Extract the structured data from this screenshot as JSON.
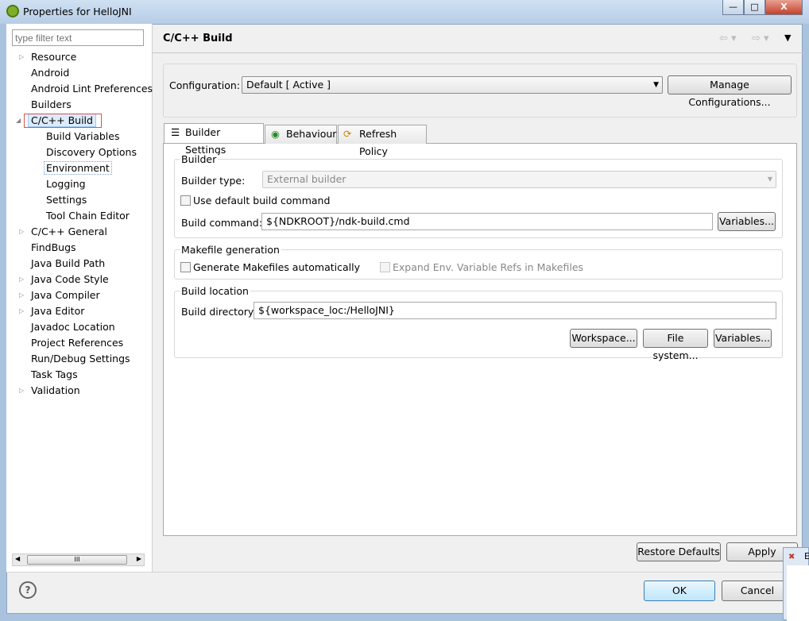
{
  "window": {
    "title": "Properties for HelloJNI",
    "minimize": "—",
    "maximize": "□",
    "close": "X"
  },
  "filter": {
    "placeholder": "type filter text"
  },
  "tree": [
    {
      "label": "Resource",
      "expandable": true
    },
    {
      "label": "Android"
    },
    {
      "label": "Android Lint Preferences"
    },
    {
      "label": "Builders"
    },
    {
      "label": "C/C++ Build",
      "expanded": true,
      "selected": true
    },
    {
      "label": "Build Variables",
      "child": true
    },
    {
      "label": "Discovery Options",
      "child": true
    },
    {
      "label": "Environment",
      "child": true
    },
    {
      "label": "Logging",
      "child": true
    },
    {
      "label": "Settings",
      "child": true
    },
    {
      "label": "Tool Chain Editor",
      "child": true
    },
    {
      "label": "C/C++ General",
      "expandable": true
    },
    {
      "label": "FindBugs"
    },
    {
      "label": "Java Build Path"
    },
    {
      "label": "Java Code Style",
      "expandable": true
    },
    {
      "label": "Java Compiler",
      "expandable": true
    },
    {
      "label": "Java Editor",
      "expandable": true
    },
    {
      "label": "Javadoc Location"
    },
    {
      "label": "Project References"
    },
    {
      "label": "Run/Debug Settings"
    },
    {
      "label": "Task Tags"
    },
    {
      "label": "Validation",
      "expandable": true
    }
  ],
  "page": {
    "title": "C/C++ Build"
  },
  "config": {
    "label": "Configuration:",
    "value": "Default  [ Active ]",
    "manage": "Manage Configurations..."
  },
  "tabs": [
    {
      "label": "Builder Settings"
    },
    {
      "label": "Behaviour"
    },
    {
      "label": "Refresh Policy"
    }
  ],
  "builder": {
    "title": "Builder",
    "type_label": "Builder type:",
    "type_value": "External builder",
    "use_default": "Use default build command",
    "cmd_label": "Build command:",
    "cmd_value": "${NDKROOT}/ndk-build.cmd",
    "variables": "Variables..."
  },
  "makefile": {
    "title": "Makefile generation",
    "generate": "Generate Makefiles automatically",
    "expand": "Expand Env. Variable Refs in Makefiles"
  },
  "location": {
    "title": "Build location",
    "dir_label": "Build directory:",
    "dir_value": "${workspace_loc:/HelloJNI}",
    "workspace": "Workspace...",
    "filesystem": "File system...",
    "variables": "Variables..."
  },
  "footer": {
    "restore": "Restore Defaults",
    "apply": "Apply",
    "ok": "OK",
    "cancel": "Cancel",
    "help": "?"
  },
  "scroll_thumb": "III",
  "overlay": {
    "title": "E"
  }
}
